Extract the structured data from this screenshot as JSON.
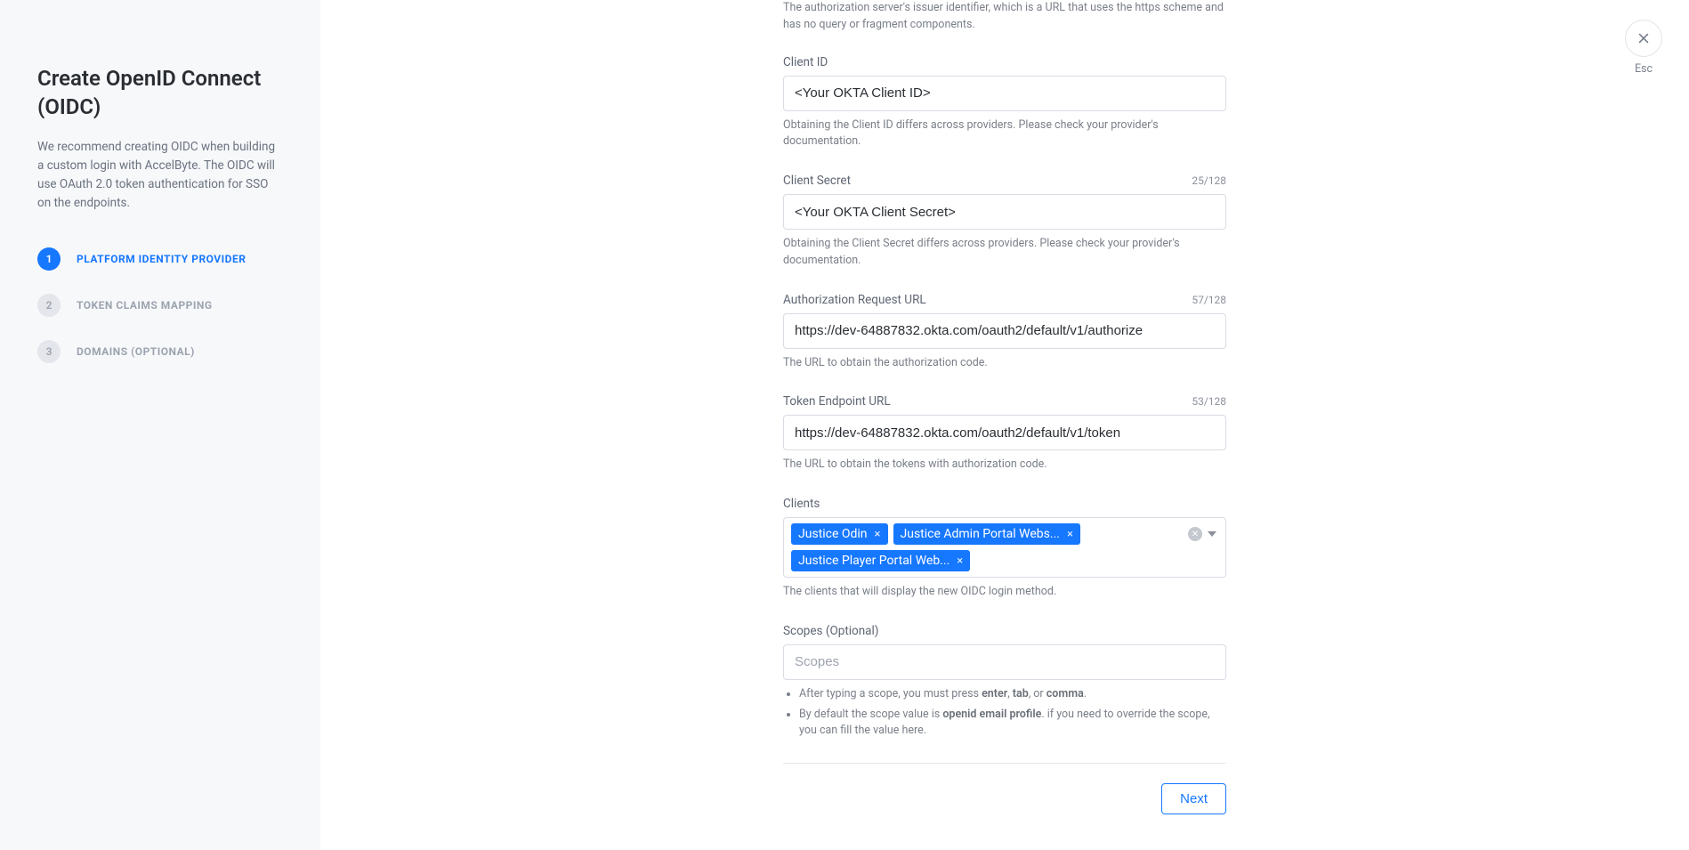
{
  "sidebar": {
    "title": "Create OpenID Connect (OIDC)",
    "description": "We recommend creating OIDC when building a custom login with AccelByte. The OIDC will use OAuth 2.0 token authentication for SSO on the endpoints.",
    "steps": [
      {
        "num": "1",
        "label": "PLATFORM IDENTITY PROVIDER"
      },
      {
        "num": "2",
        "label": "TOKEN CLAIMS MAPPING"
      },
      {
        "num": "3",
        "label": "DOMAINS (OPTIONAL)"
      }
    ]
  },
  "form": {
    "issuer_help": "The authorization server's issuer identifier, which is a URL that uses the https scheme and has no query or fragment components.",
    "client_id": {
      "label": "Client ID",
      "value": "<Your OKTA Client ID>",
      "hint": "Obtaining the Client ID differs across providers. Please check your provider's documentation."
    },
    "client_secret": {
      "label": "Client Secret",
      "value": "<Your OKTA Client Secret>",
      "count": "25/128",
      "hint": "Obtaining the Client Secret differs across providers. Please check your provider's documentation."
    },
    "auth_url": {
      "label": "Authorization Request URL",
      "value": "https://dev-64887832.okta.com/oauth2/default/v1/authorize",
      "count": "57/128",
      "hint": "The URL to obtain the authorization code."
    },
    "token_url": {
      "label": "Token Endpoint URL",
      "value": "https://dev-64887832.okta.com/oauth2/default/v1/token",
      "count": "53/128",
      "hint": "The URL to obtain the tokens with authorization code."
    },
    "clients": {
      "label": "Clients",
      "tags": [
        "Justice Odin",
        "Justice Admin Portal Webs...",
        "Justice Player Portal Web..."
      ],
      "hint": "The clients that will display the new OIDC login method."
    },
    "scopes": {
      "label": "Scopes (Optional)",
      "placeholder": "Scopes",
      "hint_prefix": "After typing a scope, you must press ",
      "hint_bold1": "enter",
      "hint_sep1": ", ",
      "hint_bold2": "tab",
      "hint_sep2": ", or ",
      "hint_bold3": "comma",
      "hint_suffix": ".",
      "hint2_prefix": "By default the scope value is ",
      "hint2_bold": "openid email profile",
      "hint2_suffix": ". if you need to override the scope, you can fill the value here."
    }
  },
  "footer": {
    "next": "Next"
  },
  "close": {
    "esc": "Esc"
  }
}
